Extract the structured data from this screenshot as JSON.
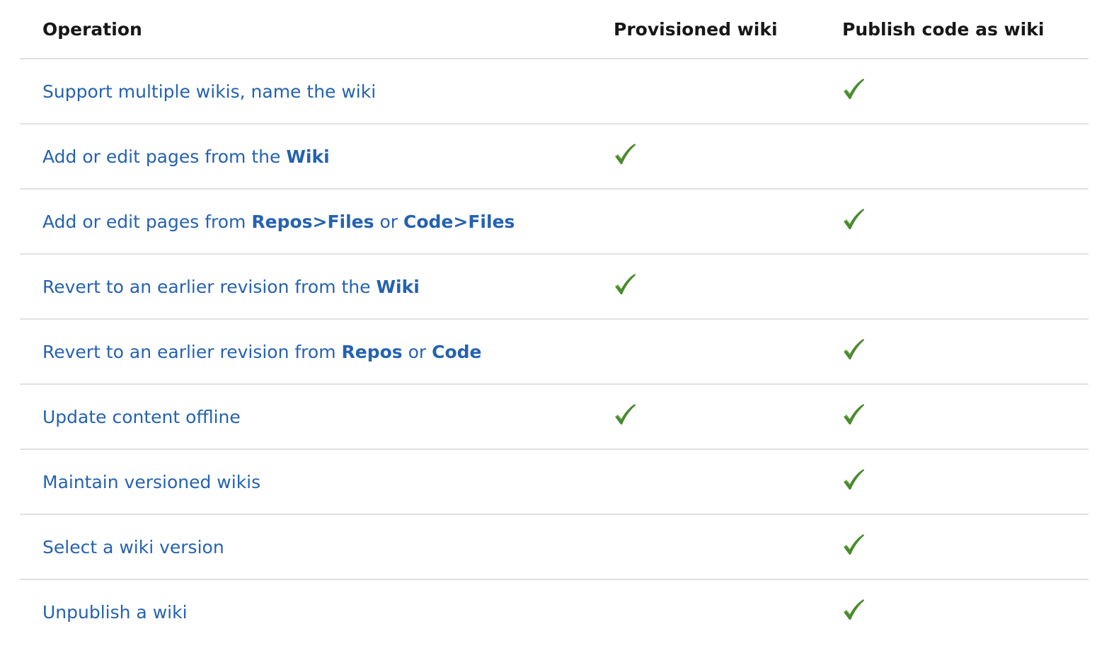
{
  "table": {
    "headers": [
      "Operation",
      "Provisioned wiki",
      "Publish code as wiki"
    ],
    "check_icon": "checkmark-icon",
    "check_color": "#4a8a2e",
    "rows": [
      {
        "parts": [
          {
            "t": "Support multiple wikis, name the wiki",
            "b": false
          }
        ],
        "provisioned": false,
        "publish": true
      },
      {
        "parts": [
          {
            "t": "Add or edit pages from the ",
            "b": false
          },
          {
            "t": "Wiki",
            "b": true
          }
        ],
        "provisioned": true,
        "publish": false
      },
      {
        "parts": [
          {
            "t": "Add or edit pages from ",
            "b": false
          },
          {
            "t": "Repos>Files",
            "b": true
          },
          {
            "t": " or ",
            "b": false
          },
          {
            "t": "Code>Files",
            "b": true
          }
        ],
        "provisioned": false,
        "publish": true
      },
      {
        "parts": [
          {
            "t": "Revert to an earlier revision from the ",
            "b": false
          },
          {
            "t": "Wiki",
            "b": true
          }
        ],
        "provisioned": true,
        "publish": false
      },
      {
        "parts": [
          {
            "t": "Revert to an earlier revision from ",
            "b": false
          },
          {
            "t": "Repos",
            "b": true
          },
          {
            "t": " or ",
            "b": false
          },
          {
            "t": "Code",
            "b": true
          }
        ],
        "provisioned": false,
        "publish": true
      },
      {
        "parts": [
          {
            "t": "Update content offline",
            "b": false
          }
        ],
        "provisioned": true,
        "publish": true
      },
      {
        "parts": [
          {
            "t": "Maintain versioned wikis",
            "b": false
          }
        ],
        "provisioned": false,
        "publish": true
      },
      {
        "parts": [
          {
            "t": "Select a wiki version",
            "b": false
          }
        ],
        "provisioned": false,
        "publish": true
      },
      {
        "parts": [
          {
            "t": "Unpublish a wiki",
            "b": false
          }
        ],
        "provisioned": false,
        "publish": true
      }
    ]
  }
}
